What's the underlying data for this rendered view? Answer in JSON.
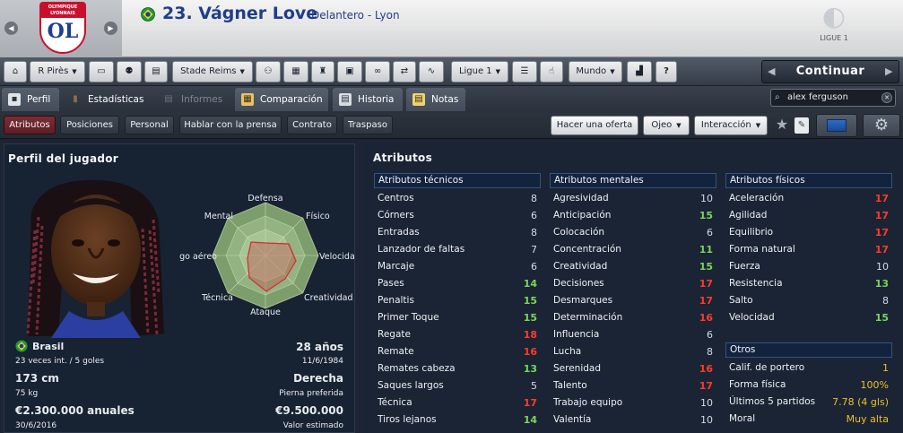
{
  "header": {
    "number_name": "23. Vágner Love",
    "position_club": "Delantero - Lyon",
    "club_crest_text": "OLYMPIQUE LYONNAIS",
    "league_logo_text": "LIGUE 1"
  },
  "toolbar": {
    "manager": "R Pirès",
    "stadium": "Stade Reims",
    "league": "Ligue 1",
    "world": "Mundo",
    "help": "?",
    "continue": "Continuar"
  },
  "tabs": [
    {
      "label": "Perfil",
      "icon": "profile-icon"
    },
    {
      "label": "Estadísticas",
      "icon": "stats-icon"
    },
    {
      "label": "Informes",
      "icon": "reports-icon"
    },
    {
      "label": "Comparación",
      "icon": "compare-icon"
    },
    {
      "label": "Historia",
      "icon": "history-icon"
    },
    {
      "label": "Notas",
      "icon": "notes-icon"
    }
  ],
  "search": {
    "value": "alex ferguson"
  },
  "subtabs": [
    "Atributos",
    "Posiciones",
    "Personal",
    "Hablar con la prensa",
    "Contrato",
    "Traspaso"
  ],
  "actions": {
    "offer": "Hacer una oferta",
    "scout": "Ojeo",
    "interaction": "Interacción"
  },
  "profile": {
    "title": "Perfil del jugador",
    "radar_labels": [
      "Defensa",
      "Físico",
      "Velocidad",
      "Creatividad",
      "Ataque",
      "Técnica",
      "Juego aéreo",
      "Mental"
    ],
    "nationality": "Brasil",
    "caps": "23 veces int. / 5 goles",
    "age": "28 años",
    "dob": "11/6/1984",
    "height": "173 cm",
    "weight": "75 kg",
    "foot": "Derecha",
    "foot_label": "Pierna preferida",
    "wage": "€2.300.000 anuales",
    "contract_end": "30/6/2016",
    "value": "€9.500.000",
    "value_label": "Valor estimado"
  },
  "attributes": {
    "title": "Atributos",
    "tecnicos": {
      "header": "Atributos técnicos",
      "items": [
        {
          "name": "Centros",
          "value": "8",
          "tone": "n"
        },
        {
          "name": "Córners",
          "value": "6",
          "tone": "n"
        },
        {
          "name": "Entradas",
          "value": "8",
          "tone": "n"
        },
        {
          "name": "Lanzador de faltas",
          "value": "7",
          "tone": "n"
        },
        {
          "name": "Marcaje",
          "value": "6",
          "tone": "n"
        },
        {
          "name": "Pases",
          "value": "14",
          "tone": "g"
        },
        {
          "name": "Penaltis",
          "value": "15",
          "tone": "g"
        },
        {
          "name": "Primer Toque",
          "value": "15",
          "tone": "g"
        },
        {
          "name": "Regate",
          "value": "18",
          "tone": "r"
        },
        {
          "name": "Remate",
          "value": "16",
          "tone": "r"
        },
        {
          "name": "Remates cabeza",
          "value": "13",
          "tone": "g"
        },
        {
          "name": "Saques largos",
          "value": "5",
          "tone": "n"
        },
        {
          "name": "Técnica",
          "value": "17",
          "tone": "r"
        },
        {
          "name": "Tiros lejanos",
          "value": "14",
          "tone": "g"
        }
      ]
    },
    "mentales": {
      "header": "Atributos mentales",
      "items": [
        {
          "name": "Agresividad",
          "value": "10",
          "tone": "n"
        },
        {
          "name": "Anticipación",
          "value": "15",
          "tone": "g"
        },
        {
          "name": "Colocación",
          "value": "6",
          "tone": "n"
        },
        {
          "name": "Concentración",
          "value": "11",
          "tone": "g"
        },
        {
          "name": "Creatividad",
          "value": "15",
          "tone": "g"
        },
        {
          "name": "Decisiones",
          "value": "17",
          "tone": "r"
        },
        {
          "name": "Desmarques",
          "value": "17",
          "tone": "r"
        },
        {
          "name": "Determinación",
          "value": "16",
          "tone": "r"
        },
        {
          "name": "Influencia",
          "value": "6",
          "tone": "n"
        },
        {
          "name": "Lucha",
          "value": "8",
          "tone": "n"
        },
        {
          "name": "Serenidad",
          "value": "16",
          "tone": "r"
        },
        {
          "name": "Talento",
          "value": "17",
          "tone": "r"
        },
        {
          "name": "Trabajo equipo",
          "value": "10",
          "tone": "n"
        },
        {
          "name": "Valentía",
          "value": "10",
          "tone": "n"
        }
      ]
    },
    "fisicos": {
      "header": "Atributos físicos",
      "items": [
        {
          "name": "Aceleración",
          "value": "17",
          "tone": "r"
        },
        {
          "name": "Agilidad",
          "value": "17",
          "tone": "r"
        },
        {
          "name": "Equilibrio",
          "value": "17",
          "tone": "r"
        },
        {
          "name": "Forma natural",
          "value": "17",
          "tone": "r"
        },
        {
          "name": "Fuerza",
          "value": "10",
          "tone": "n"
        },
        {
          "name": "Resistencia",
          "value": "13",
          "tone": "g"
        },
        {
          "name": "Salto",
          "value": "8",
          "tone": "n"
        },
        {
          "name": "Velocidad",
          "value": "15",
          "tone": "g"
        }
      ]
    },
    "otros": {
      "header": "Otros",
      "items": [
        {
          "name": "Calif. de portero",
          "value": "1",
          "tone": "y"
        },
        {
          "name": "Forma física",
          "value": "100%",
          "tone": "y"
        },
        {
          "name": "Últimos 5 partidos",
          "value": "7.78 (4 gls)",
          "tone": "y"
        },
        {
          "name": "Moral",
          "value": "Muy alta",
          "tone": "y"
        }
      ]
    }
  },
  "colors": {
    "header_title": "#1f3e8a",
    "high_value": "#ff3b2d",
    "good_value": "#7ad65b",
    "other_value": "#f1bf2a",
    "active_subtab": "#7a2e35"
  }
}
